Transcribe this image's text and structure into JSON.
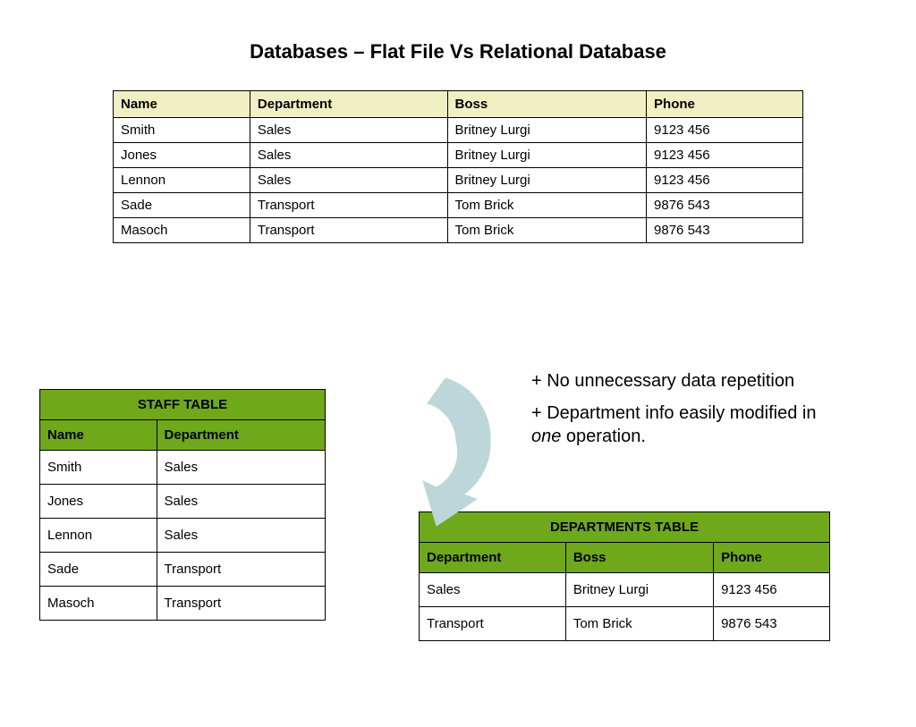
{
  "slide_title": "Databases – Flat File Vs Relational Database",
  "flat_table": {
    "headers": [
      "Name",
      "Department",
      "Boss",
      "Phone"
    ],
    "rows": [
      [
        "Smith",
        "Sales",
        "Britney Lurgi",
        "9123 456"
      ],
      [
        "Jones",
        "Sales",
        "Britney Lurgi",
        "9123 456"
      ],
      [
        "Lennon",
        "Sales",
        "Britney Lurgi",
        "9123 456"
      ],
      [
        "Sade",
        "Transport",
        "Tom Brick",
        "9876 543"
      ],
      [
        "Masoch",
        "Transport",
        "Tom Brick",
        "9876 543"
      ]
    ]
  },
  "staff_table": {
    "title": "STAFF TABLE",
    "headers": [
      "Name",
      "Department"
    ],
    "rows": [
      [
        "Smith",
        "Sales"
      ],
      [
        "Jones",
        "Sales"
      ],
      [
        "Lennon",
        "Sales"
      ],
      [
        "Sade",
        "Transport"
      ],
      [
        "Masoch",
        "Transport"
      ]
    ]
  },
  "dept_table": {
    "title": "DEPARTMENTS TABLE",
    "headers": [
      "Department",
      "Boss",
      "Phone"
    ],
    "rows": [
      [
        "Sales",
        "Britney Lurgi",
        "9123 456"
      ],
      [
        "Transport",
        "Tom Brick",
        "9876 543"
      ]
    ]
  },
  "notes": {
    "line1": "+ No unnecessary data repetition",
    "line2a": "+ Department info easily modified in ",
    "line2_em": "one",
    "line2b": " operation."
  }
}
